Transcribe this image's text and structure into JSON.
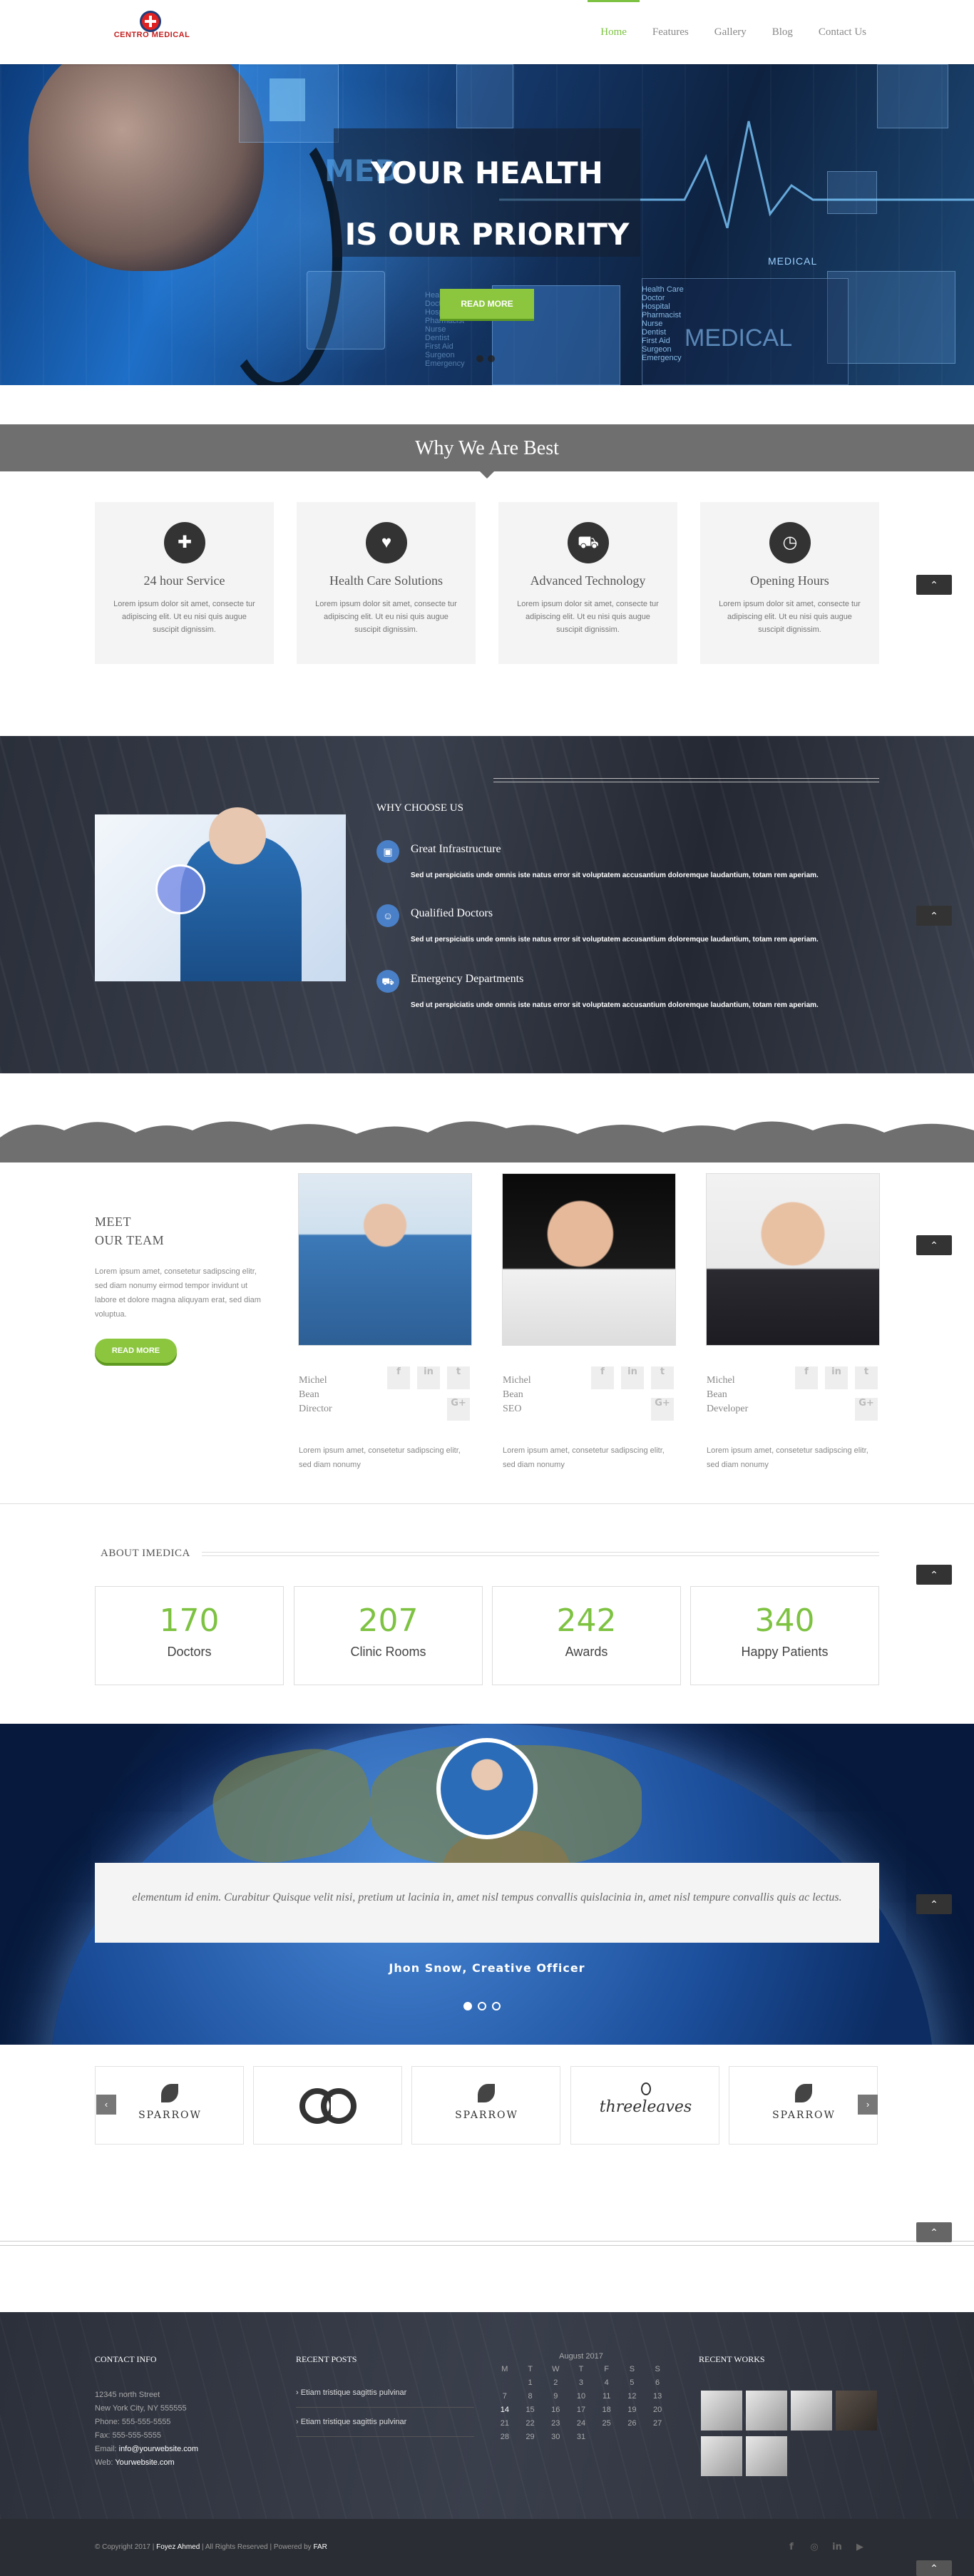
{
  "header": {
    "logo_text": "CENTRO MEDICAL",
    "nav": [
      "Home",
      "Features",
      "Gallery",
      "Blog",
      "Contact Us"
    ],
    "active": "Home"
  },
  "hero": {
    "title_line1": "YOUR HEALTH",
    "title_line2": "IS OUR PRIORITY",
    "button": "READ MORE",
    "side_list": [
      "Health Care",
      "Doctor",
      "Hospital",
      "Pharmacist",
      "Nurse",
      "Dentist",
      "First Aid",
      "Surgeon",
      "Emergency"
    ],
    "left_list": [
      "Health Care",
      "Doctor",
      "Hospital",
      "Pharmacist",
      "Nurse",
      "Dentist",
      "First Aid",
      "Surgeon",
      "Emergency"
    ],
    "watermark_1": "MEDICAL",
    "watermark_2": "MEDICAL",
    "watermark_3": "MED"
  },
  "why_best": {
    "title": "Why We Are Best",
    "cards": [
      {
        "icon": "medkit-icon",
        "glyph": "✚",
        "title": "24 hour Service",
        "text": "Lorem ipsum dolor sit amet, consecte tur adipiscing elit. Ut eu nisi quis augue suscipit dignissim."
      },
      {
        "icon": "stethoscope-icon",
        "glyph": "♥",
        "title": "Health Care Solutions",
        "text": "Lorem ipsum dolor sit amet, consecte tur adipiscing elit. Ut eu nisi quis augue suscipit dignissim."
      },
      {
        "icon": "ambulance-icon",
        "glyph": "⛟",
        "title": "Advanced Technology",
        "text": "Lorem ipsum dolor sit amet, consecte tur adipiscing elit. Ut eu nisi quis augue suscipit dignissim."
      },
      {
        "icon": "clock-icon",
        "glyph": "◷",
        "title": "Opening Hours",
        "text": "Lorem ipsum dolor sit amet, consecte tur adipiscing elit. Ut eu nisi quis augue suscipit dignissim."
      }
    ]
  },
  "why_choose": {
    "title": "WHY CHOOSE US",
    "items": [
      {
        "icon": "building-icon",
        "title": "Great Infrastructure",
        "text": "Sed ut perspiciatis unde omnis iste natus error sit voluptatem accusantium doloremque laudantium, totam rem aperiam."
      },
      {
        "icon": "doctor-icon",
        "title": "Qualified Doctors",
        "text": "Sed ut perspiciatis unde omnis iste natus error sit voluptatem accusantium doloremque laudantium, totam rem aperiam."
      },
      {
        "icon": "ambulance-icon",
        "title": "Emergency Departments",
        "text": "Sed ut perspiciatis unde omnis iste natus error sit voluptatem accusantium doloremque laudantium, totam rem aperiam."
      }
    ]
  },
  "team": {
    "heading_line1": "MEET",
    "heading_line2": "OUR TEAM",
    "intro": "Lorem ipsum amet, consetetur sadipscing elitr, sed diam nonumy eirmod tempor invidunt ut labore et dolore magna aliquyam erat, sed diam voluptua.",
    "button": "READ MORE",
    "members": [
      {
        "first": "Michel",
        "last": "Bean",
        "role": "Director",
        "text": "Lorem ipsum amet, consetetur sadipscing elitr, sed diam nonumy"
      },
      {
        "first": "Michel",
        "last": "Bean",
        "role": "SEO",
        "text": "Lorem ipsum amet, consetetur sadipscing elitr, sed diam nonumy"
      },
      {
        "first": "Michel",
        "last": "Bean",
        "role": "Developer",
        "text": "Lorem ipsum amet, consetetur sadipscing elitr, sed diam nonumy"
      }
    ],
    "social": [
      "f",
      "in",
      "t",
      "G+"
    ]
  },
  "about": {
    "title": "ABOUT IMEDICA",
    "stats": [
      {
        "value": "170",
        "label": "Doctors"
      },
      {
        "value": "207",
        "label": "Clinic Rooms"
      },
      {
        "value": "242",
        "label": "Awards"
      },
      {
        "value": "340",
        "label": "Happy Patients"
      }
    ]
  },
  "testimonial": {
    "quote": "elementum id enim. Curabitur Quisque velit nisi, pretium ut lacinia in, amet nisl tempus convallis quislacinia in, amet nisl tempure convallis quis ac lectus.",
    "name": "Jhon Snow",
    "role": ", Creative Officer"
  },
  "clients": [
    "SPARROW",
    "",
    "SPARROW",
    "threeleaves",
    "SPARROW"
  ],
  "footer": {
    "contact_title": "CONTACT INFO",
    "contact_lines": [
      "12345 north Street",
      "New York City, NY 555555",
      "Phone: 555-555-5555",
      "Fax: 555-555-5555"
    ],
    "email_label": "Email: ",
    "email": "info@yourwebsite.com",
    "web_label": "Web: ",
    "web": "Yourwebsite.com",
    "posts_title": "RECENT POSTS",
    "posts": [
      "Etiam tristique sagittis pulvinar",
      "Etiam tristique sagittis pulvinar"
    ],
    "calendar": {
      "caption": "August 2017",
      "days": [
        "M",
        "T",
        "W",
        "T",
        "F",
        "S",
        "S"
      ],
      "rows": [
        [
          "",
          "1",
          "2",
          "3",
          "4",
          "5",
          "6"
        ],
        [
          "7",
          "8",
          "9",
          "10",
          "11",
          "12",
          "13"
        ],
        [
          "14",
          "15",
          "16",
          "17",
          "18",
          "19",
          "20"
        ],
        [
          "21",
          "22",
          "23",
          "24",
          "25",
          "26",
          "27"
        ],
        [
          "28",
          "29",
          "30",
          "31",
          "",
          "",
          ""
        ]
      ]
    },
    "works_title": "RECENT WORKS",
    "copyright_prefix": "© Copyright 2017 | ",
    "author": "Foyez Ahmed",
    "copyright_mid": " | All Rights Reserved | Powered by ",
    "powered": "FAR"
  }
}
